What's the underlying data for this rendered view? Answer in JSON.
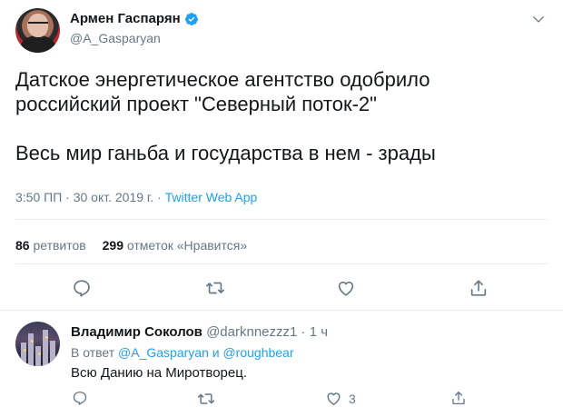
{
  "tweet": {
    "author_name": "Армен Гаспарян",
    "handle": "@A_Gasparyan",
    "verified": true,
    "text": "Датское энергетическое агентство одобрило\nроссийский проект \"Северный поток-2\"\n\nВесь мир ганьба и государства в нем - зрады",
    "timestamp": "3:50 ПП · 30 окт. 2019 г. · ",
    "source": "Twitter Web App",
    "retweets_count": "86",
    "retweets_label": "ретвитов",
    "likes_count": "299",
    "likes_label": "отметок «Нравится»"
  },
  "reply": {
    "author_name": "Владимир Соколов",
    "handle": "@darknnezzz1",
    "separator": "·",
    "time": "1 ч",
    "in_reply_prefix": "В ответ ",
    "in_reply_to_1": "@A_Gasparyan",
    "in_reply_and": " и ",
    "in_reply_to_2": "@roughbear",
    "text": "Всю Данию на Миротворец.",
    "likes_count": "3"
  },
  "colors": {
    "accent": "#1da1f2",
    "text": "#14171a",
    "muted": "#657786",
    "divider": "#e6ecf0"
  },
  "icons": [
    "verified-badge-icon",
    "chevron-down-icon",
    "reply-icon",
    "retweet-icon",
    "like-icon",
    "share-icon"
  ]
}
